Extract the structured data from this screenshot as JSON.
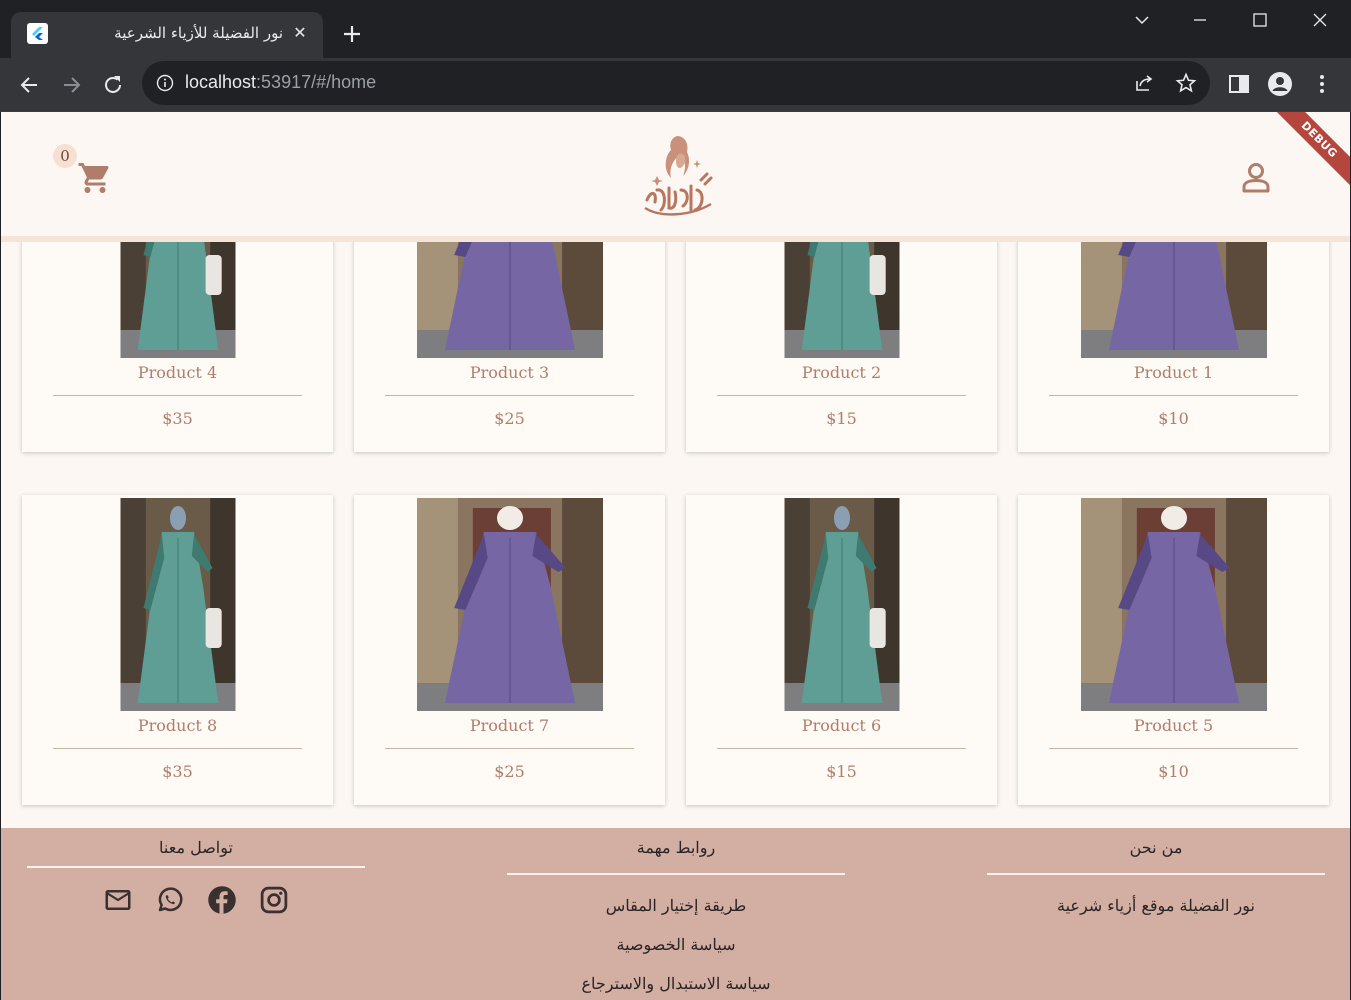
{
  "browser": {
    "tab_title": "نور الفضيلة للأزياء الشرعية",
    "url_host": "localhost",
    "url_rest": ":53917/#/home",
    "debug_label": "DEBUG"
  },
  "header": {
    "cart_count": "0"
  },
  "products": [
    {
      "name": "Product 4",
      "price": "$35",
      "color": "teal"
    },
    {
      "name": "Product 3",
      "price": "$25",
      "color": "purple"
    },
    {
      "name": "Product 2",
      "price": "$15",
      "color": "teal"
    },
    {
      "name": "Product 1",
      "price": "$10",
      "color": "purple"
    },
    {
      "name": "Product 8",
      "price": "$35",
      "color": "teal"
    },
    {
      "name": "Product 7",
      "price": "$25",
      "color": "purple"
    },
    {
      "name": "Product 6",
      "price": "$15",
      "color": "teal"
    },
    {
      "name": "Product 5",
      "price": "$10",
      "color": "purple"
    }
  ],
  "footer": {
    "contact": {
      "title": "تواصل معنا"
    },
    "links": {
      "title": "روابط مهمة",
      "items": [
        "طريقة إختيار المقاس",
        "سياسة الخصوصية",
        "سياسة الاستبدال والاسترجاع"
      ]
    },
    "about": {
      "title": "من نحن",
      "text": "نور الفضيلة موقع أزياء شرعية"
    }
  },
  "colors": {
    "page_bg": "#fdf7f3",
    "accent": "#b07d6a",
    "footer_bg": "#d3aea3"
  }
}
